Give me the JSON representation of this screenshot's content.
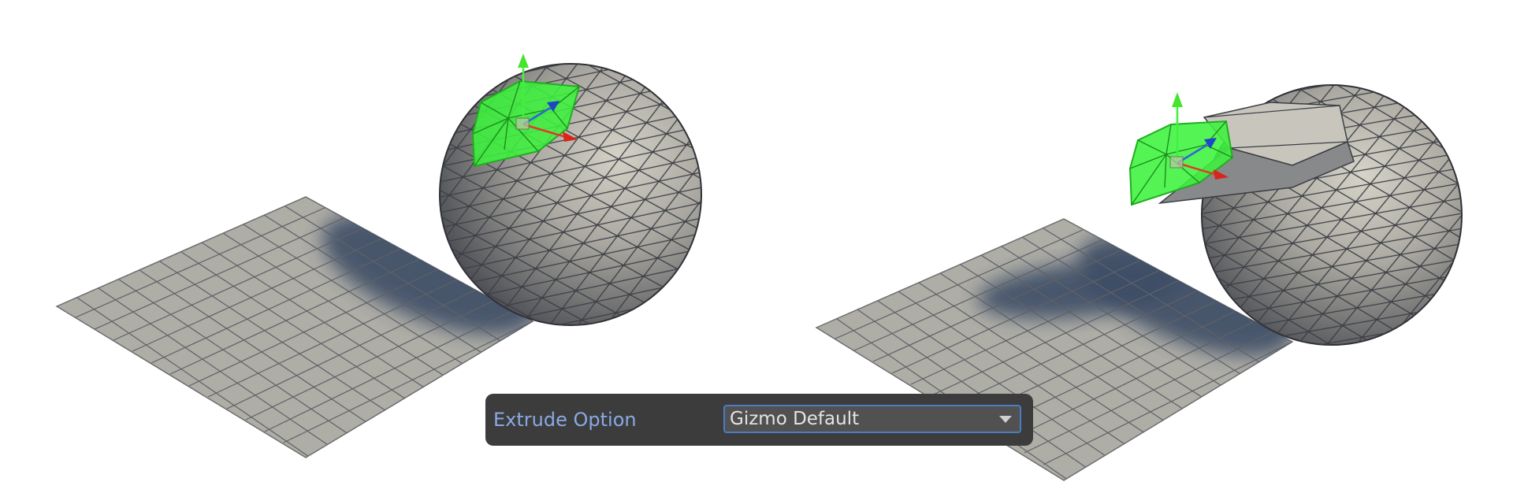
{
  "viewports": {
    "left": {
      "description": "sphere-with-selected-faces"
    },
    "right": {
      "description": "sphere-with-extruded-faces"
    }
  },
  "extrude_panel": {
    "label": "Extrude Option",
    "selected": "Gizmo Default",
    "arrow_icon": "dropdown-arrow-icon"
  },
  "colors": {
    "panel_bg": "#3c3c3c",
    "label_text": "#8aa9e3",
    "field_border": "#4b7cc4",
    "selection": "#3ef23e",
    "shadow": "#3d4d66"
  }
}
